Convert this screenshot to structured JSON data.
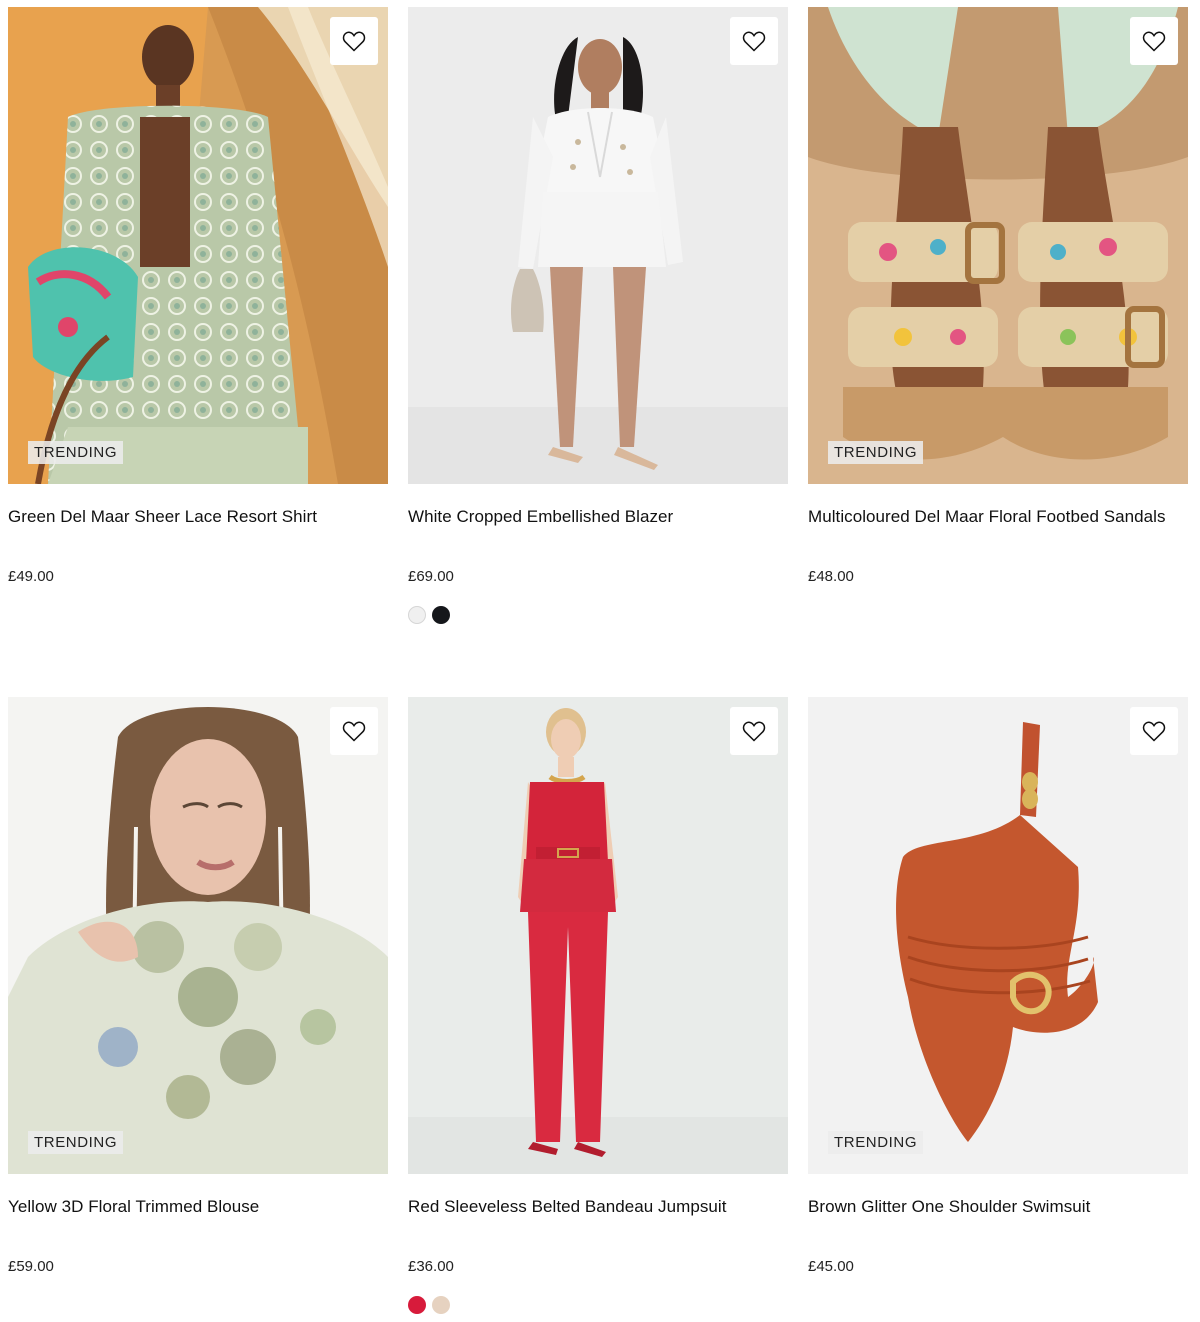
{
  "products": [
    {
      "title": "Green Del Maar Sheer Lace Resort Shirt",
      "price": "£49.00",
      "badge": "TRENDING",
      "swatches": []
    },
    {
      "title": "White Cropped Embellished Blazer",
      "price": "£69.00",
      "badge": "",
      "swatches": [
        "#f0f0f0",
        "#15171b"
      ]
    },
    {
      "title": "Multicoloured Del Maar Floral Footbed Sandals",
      "price": "£48.00",
      "badge": "TRENDING",
      "swatches": []
    },
    {
      "title": "Yellow 3D Floral Trimmed Blouse",
      "price": "£59.00",
      "badge": "TRENDING",
      "swatches": []
    },
    {
      "title": "Red Sleeveless Belted Bandeau Jumpsuit",
      "price": "£36.00",
      "badge": "",
      "swatches": [
        "#d71b3b",
        "#e6d2c0"
      ]
    },
    {
      "title": "Brown Glitter One Shoulder Swimsuit",
      "price": "£45.00",
      "badge": "TRENDING",
      "swatches": []
    }
  ],
  "icons": {
    "wishlist": "heart-outline-icon"
  }
}
